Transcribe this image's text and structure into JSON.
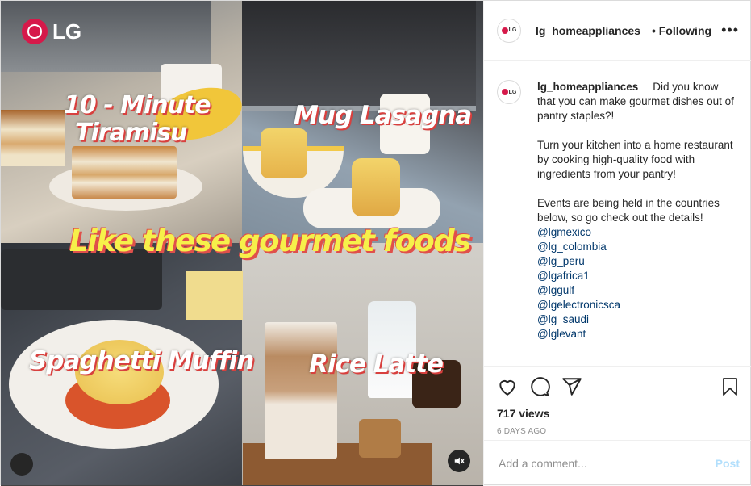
{
  "media": {
    "brand": "LG",
    "headline": "Like these gourmet foods",
    "dishes": {
      "tiramisu_line1": "10 - Minute",
      "tiramisu_line2": "Tiramisu",
      "lasagna": "Mug Lasagna",
      "spaghetti": "Spaghetti Muffin",
      "latte": "Rice Latte"
    },
    "mute_icon": "speaker-muted-icon"
  },
  "header": {
    "avatar_text": "LG",
    "username": "lg_homeappliances",
    "follow_label": "• Following",
    "more_label": "•••"
  },
  "caption": {
    "username": "lg_homeappliances",
    "intro": "Did you know that you can make gourmet dishes out of pantry staples?!",
    "para2": "Turn your kitchen into a home restaurant by cooking high-quality food with ingredients from your pantry!",
    "para3": "Events are being held in the countries below, so go check out the details!",
    "mentions": [
      "@lgmexico",
      "@lg_colombia",
      "@lg_peru",
      "@lgafrica1",
      "@lggulf",
      "@lgelectronicsca",
      "@lg_saudi",
      "@lglevant"
    ]
  },
  "actions": {
    "icons": [
      "heart-icon",
      "comment-icon",
      "share-icon",
      "bookmark-icon"
    ],
    "views": "717 views",
    "posted": "6 DAYS AGO"
  },
  "comment_box": {
    "placeholder": "Add a comment...",
    "post_label": "Post"
  }
}
